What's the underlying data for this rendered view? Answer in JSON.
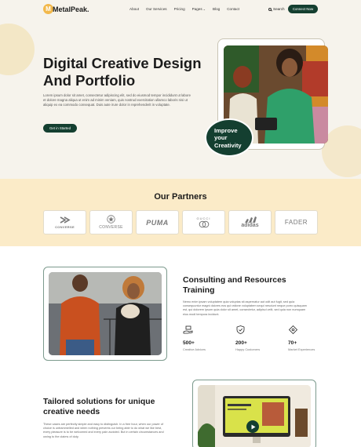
{
  "brand": {
    "name": "MetalPeak.",
    "mark": "M",
    "accent": "#143f30",
    "highlight": "#f2b84b"
  },
  "nav": {
    "links": [
      "About",
      "Our Services",
      "Pricing",
      "Pages",
      "Blog",
      "Contact"
    ],
    "search_label": "Search",
    "cta_label": "Connect Now"
  },
  "hero": {
    "title_line1": "Digital Creative Design",
    "title_line2": "And Portfolio",
    "body": "Lorem ipsum dolor sit amet, consectetur adipiscing elit, sed do eiusmod tempor incididunt ut labore et dolore magna aliqua ut enim ad minim veniam, quis nostrud exercitation ullamco laboris nisi ut aliquip ex ea commodo consequat. Duis aute irure dolor in reprehenderit in voluptate.",
    "button_label": "Get in Started",
    "badge_line1": "Improve",
    "badge_line2": "your",
    "badge_line3": "Creativity"
  },
  "partners": {
    "title": "Our Partners",
    "logos": [
      "CONVERSE",
      "CONVERSE",
      "PUMA",
      "GUCCI",
      "adidas",
      "FADER"
    ]
  },
  "consulting": {
    "title": "Consulting and Resources Training",
    "body": "Nemo enim ipsam voluptatem quia voluptas sit aspernatur aut odit aut fugit, sed quia consequuntur magni dolores eos qui ratione voluptatem sequi nesciunt neque porro quisquam est, qui dolorem ipsum quia dolor sit amet, consectetur, adipisci velit, sed quia non numquam eius modi tempora incidunt.",
    "stats": [
      {
        "icon": "gift-hand-icon",
        "value": "500+",
        "label": "Creative Advices"
      },
      {
        "icon": "shield-check-icon",
        "value": "200+",
        "label": "Happy Customers"
      },
      {
        "icon": "network-icon",
        "value": "70+",
        "label": "Market Experiences"
      }
    ]
  },
  "tailored": {
    "title": "Tailored solutions for unique creative needs",
    "body": "These cases are perfectly simple and easy to distinguish. In a free hour, when our power of choice is untrammelled and when nothing prevents our being able to do what we like best, every pleasure is to be welcomed and every pain avoided. But in certain circumstances and owing to the claims of duty."
  }
}
